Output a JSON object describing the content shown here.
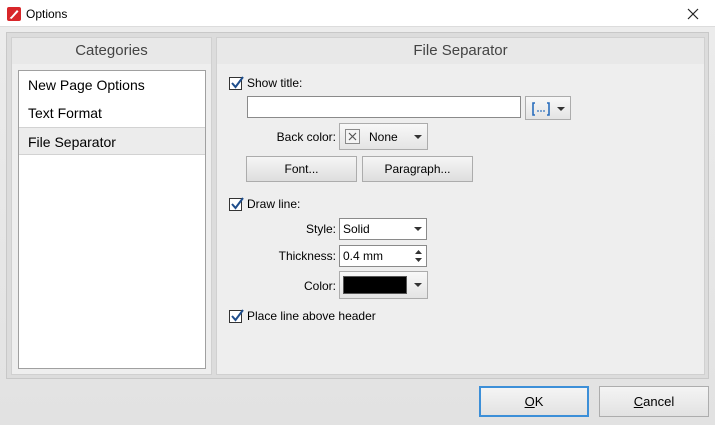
{
  "window": {
    "title": "Options",
    "close_icon": "close-icon"
  },
  "categories": {
    "header": "Categories",
    "items": [
      {
        "label": "New Page Options"
      },
      {
        "label": "Text Format"
      },
      {
        "label": "File Separator"
      }
    ],
    "selected": "File Separator"
  },
  "settings": {
    "header": "File Separator",
    "show_title": {
      "label": "Show title:",
      "checked": true
    },
    "title_value": "",
    "macro_icon": "macro-brackets-icon",
    "back_color": {
      "label": "Back color:",
      "value": "None"
    },
    "font_button": "Font...",
    "paragraph_button": "Paragraph...",
    "draw_line": {
      "label": "Draw line:",
      "checked": true
    },
    "style": {
      "label": "Style:",
      "value": "Solid"
    },
    "thickness": {
      "label": "Thickness:",
      "value": "0.4 mm"
    },
    "color": {
      "label": "Color:",
      "value_hex": "#000000"
    },
    "place_line_above_header": {
      "label": "Place line above header",
      "checked": true
    }
  },
  "footer": {
    "ok": {
      "label": "OK",
      "accel": "O",
      "rest": "K"
    },
    "cancel": {
      "label": "Cancel",
      "accel": "C",
      "rest": "ancel"
    }
  },
  "colors": {
    "default_button_border": "#3c8fd8",
    "accent_icon": "#d8262a"
  }
}
